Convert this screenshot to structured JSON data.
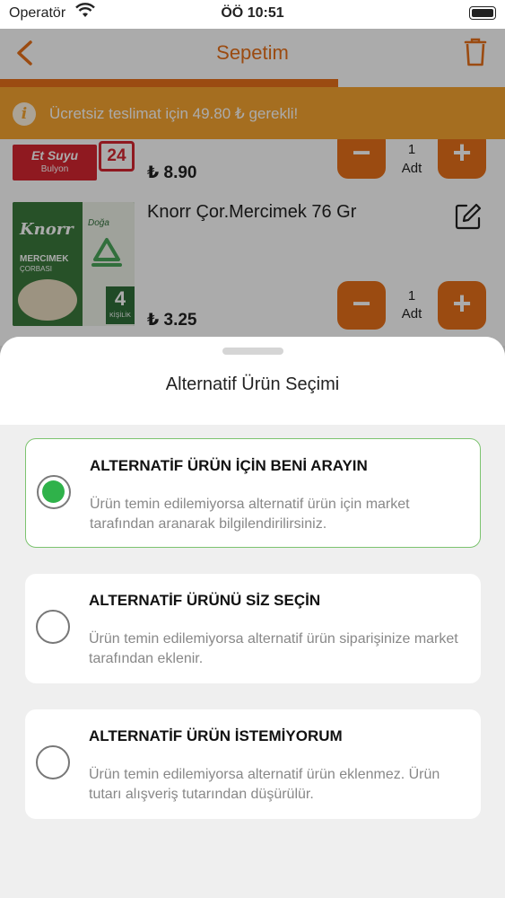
{
  "status_bar": {
    "carrier": "Operatör",
    "time": "ÖÖ 10:51"
  },
  "nav": {
    "title": "Sepetim",
    "back_icon": "chevron-left-icon",
    "trash_icon": "trash-icon"
  },
  "free_delivery": {
    "message": "Ücretsiz teslimat için 49.80 ₺ gerekli!",
    "progress": 0.67
  },
  "cart_items": [
    {
      "brand_text": "Et Suyu",
      "brand_subtext": "Bulyon",
      "count_badge": "24",
      "price": "₺ 8.90",
      "quantity": "1",
      "unit": "Adt"
    },
    {
      "name": "Knorr Çor.Mercimek 76 Gr",
      "thumb_brand": "Knorr",
      "thumb_label": "MERCIMEK",
      "thumb_sublabel": "ÇORBASI",
      "thumb_badge": "4",
      "thumb_badge_sub": "KİŞİLİK",
      "thumb_tag": "Doğa",
      "price": "₺ 3.25",
      "quantity": "1",
      "unit": "Adt"
    }
  ],
  "sheet": {
    "title": "Alternatif Ürün Seçimi",
    "options": [
      {
        "title": "ALTERNATİF ÜRÜN İÇİN BENİ ARAYIN",
        "description": "Ürün temin edilemiyorsa alternatif ürün için market tarafından aranarak bilgilendirilirsiniz.",
        "selected": true
      },
      {
        "title": "ALTERNATİF ÜRÜNÜ SİZ SEÇİN",
        "description": "Ürün temin edilemiyorsa alternatif ürün siparişinize market tarafından eklenir.",
        "selected": false
      },
      {
        "title": "ALTERNATİF ÜRÜN İSTEMİYORUM",
        "description": "Ürün temin edilemiyorsa alternatif ürün eklenmez. Ürün tutarı alışveriş tutarından düşürülür.",
        "selected": false
      }
    ]
  },
  "colors": {
    "accent": "#e8711a",
    "banner": "#f7a531",
    "selected_green": "#2fb24a",
    "selected_border": "#7cc36f"
  }
}
